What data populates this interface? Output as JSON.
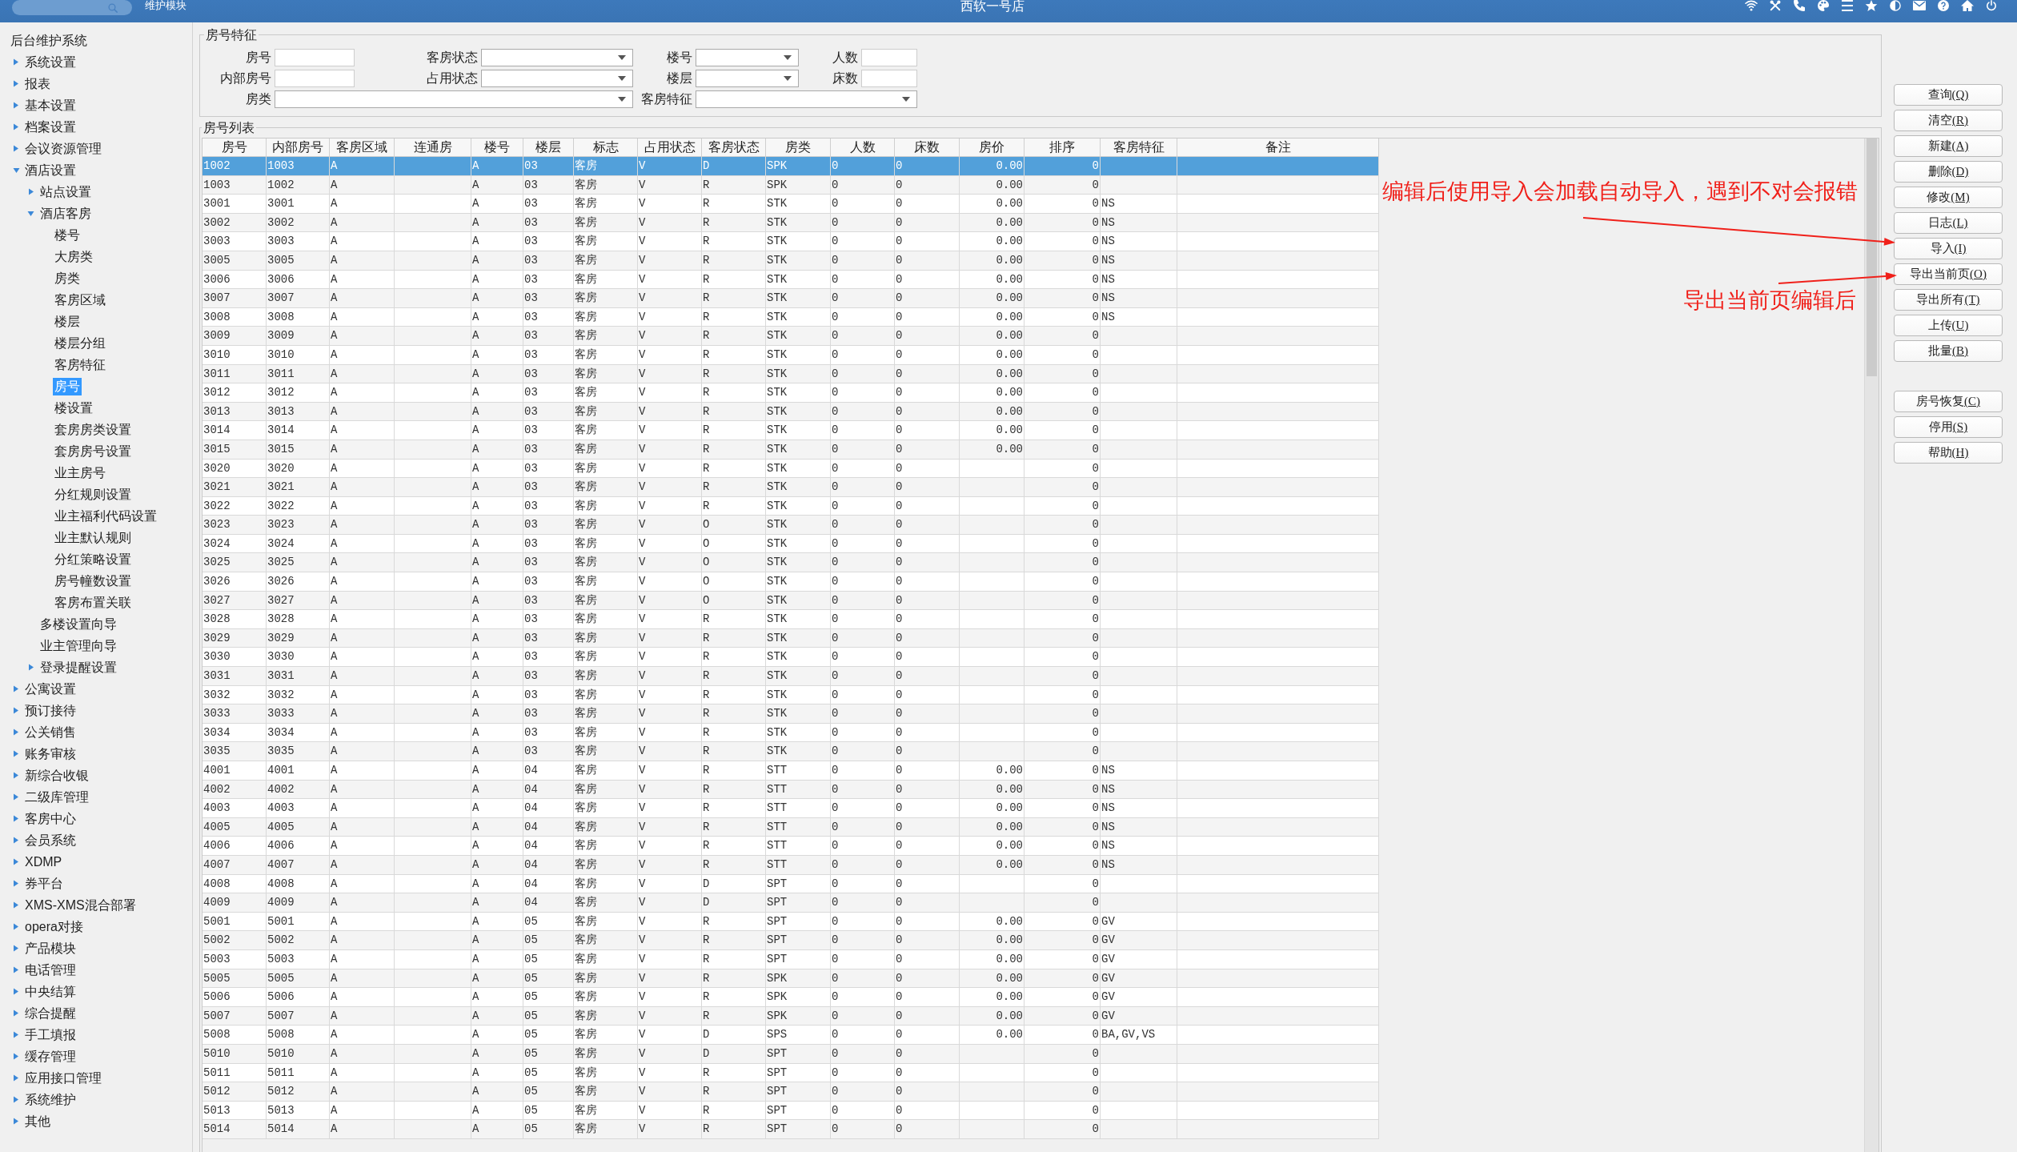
{
  "top_bar": {
    "module": "维护模块",
    "title": "西软一号店"
  },
  "sidebar": {
    "root": "后台维护系统",
    "items": [
      {
        "label": "系统设置",
        "expanded": false,
        "selected": false
      },
      {
        "label": "报表",
        "expanded": false,
        "selected": false
      },
      {
        "label": "基本设置",
        "expanded": false,
        "selected": false
      },
      {
        "label": "档案设置",
        "expanded": false,
        "selected": false
      },
      {
        "label": "会议资源管理",
        "expanded": false,
        "selected": false
      },
      {
        "label": "酒店设置",
        "expanded": true,
        "selected": false,
        "children": [
          {
            "label": "站点设置",
            "expanded": false,
            "selected": false
          },
          {
            "label": "酒店客房",
            "expanded": true,
            "selected": false,
            "children": [
              {
                "label": "楼号",
                "selected": false
              },
              {
                "label": "大房类",
                "selected": false
              },
              {
                "label": "房类",
                "selected": false
              },
              {
                "label": "客房区域",
                "selected": false
              },
              {
                "label": "楼层",
                "selected": false
              },
              {
                "label": "楼层分组",
                "selected": false
              },
              {
                "label": "客房特征",
                "selected": false
              },
              {
                "label": "房号",
                "selected": true
              },
              {
                "label": "楼设置",
                "selected": false
              },
              {
                "label": "套房房类设置",
                "selected": false
              },
              {
                "label": "套房房号设置",
                "selected": false
              },
              {
                "label": "业主房号",
                "selected": false
              },
              {
                "label": "分红规则设置",
                "selected": false
              },
              {
                "label": "业主福利代码设置",
                "selected": false
              },
              {
                "label": "业主默认规则",
                "selected": false
              },
              {
                "label": "分红策略设置",
                "selected": false
              },
              {
                "label": "房号幢数设置",
                "selected": false
              },
              {
                "label": "客房布置关联",
                "selected": false
              }
            ]
          },
          {
            "label": "多楼设置向导",
            "selected": false
          },
          {
            "label": "业主管理向导",
            "selected": false
          },
          {
            "label": "登录提醒设置",
            "expanded": false,
            "selected": false
          }
        ]
      },
      {
        "label": "公寓设置",
        "expanded": false,
        "selected": false
      },
      {
        "label": "预订接待",
        "expanded": false,
        "selected": false
      },
      {
        "label": "公关销售",
        "expanded": false,
        "selected": false
      },
      {
        "label": "账务审核",
        "expanded": false,
        "selected": false
      },
      {
        "label": "新综合收银",
        "expanded": false,
        "selected": false
      },
      {
        "label": "二级库管理",
        "expanded": false,
        "selected": false
      },
      {
        "label": "客房中心",
        "expanded": false,
        "selected": false
      },
      {
        "label": "会员系统",
        "expanded": false,
        "selected": false
      },
      {
        "label": "XDMP",
        "expanded": false,
        "selected": false
      },
      {
        "label": "券平台",
        "expanded": false,
        "selected": false
      },
      {
        "label": "XMS-XMS混合部署",
        "expanded": false,
        "selected": false
      },
      {
        "label": "opera对接",
        "expanded": false,
        "selected": false
      },
      {
        "label": "产品模块",
        "expanded": false,
        "selected": false
      },
      {
        "label": "电话管理",
        "expanded": false,
        "selected": false
      },
      {
        "label": "中央结算",
        "expanded": false,
        "selected": false
      },
      {
        "label": "综合提醒",
        "expanded": false,
        "selected": false
      },
      {
        "label": "手工填报",
        "expanded": false,
        "selected": false
      },
      {
        "label": "缓存管理",
        "expanded": false,
        "selected": false
      },
      {
        "label": "应用接口管理",
        "expanded": false,
        "selected": false
      },
      {
        "label": "系统维护",
        "expanded": false,
        "selected": false
      },
      {
        "label": "其他",
        "expanded": false,
        "selected": false
      }
    ]
  },
  "filter": {
    "title": "房号特征",
    "rows": [
      [
        {
          "label": "房号",
          "kind": "text"
        },
        {
          "label": "客房状态",
          "kind": "select"
        },
        {
          "label": "楼号",
          "kind": "select"
        },
        {
          "label": "人数",
          "kind": "text"
        }
      ],
      [
        {
          "label": "内部房号",
          "kind": "text"
        },
        {
          "label": "占用状态",
          "kind": "select"
        },
        {
          "label": "楼层",
          "kind": "select"
        },
        {
          "label": "床数",
          "kind": "text"
        }
      ],
      [
        {
          "label": "房类",
          "kind": "select"
        },
        null,
        {
          "label": "客房特征",
          "kind": "select"
        },
        null
      ]
    ]
  },
  "room_list": {
    "title": "房号列表",
    "columns": [
      "房号",
      "内部房号",
      "客房区域",
      "连通房",
      "楼号",
      "楼层",
      "标志",
      "占用状态",
      "客房状态",
      "房类",
      "人数",
      "床数",
      "房价",
      "排序",
      "客房特征",
      "备注"
    ],
    "rows": [
      {
        "selected": true,
        "cells": [
          "1002",
          "1003",
          "A",
          null,
          "A",
          "03",
          "客房",
          "V",
          "D",
          "SPK",
          "0",
          "0",
          "0.00",
          "0",
          null,
          null
        ]
      },
      {
        "selected": false,
        "cells": [
          "1003",
          "1002",
          "A",
          null,
          "A",
          "03",
          "客房",
          "V",
          "R",
          "SPK",
          "0",
          "0",
          "0.00",
          "0",
          null,
          null
        ]
      },
      {
        "selected": false,
        "cells": [
          "3001",
          "3001",
          "A",
          null,
          "A",
          "03",
          "客房",
          "V",
          "R",
          "STK",
          "0",
          "0",
          "0.00",
          "0",
          "NS",
          null
        ]
      },
      {
        "selected": false,
        "cells": [
          "3002",
          "3002",
          "A",
          null,
          "A",
          "03",
          "客房",
          "V",
          "R",
          "STK",
          "0",
          "0",
          "0.00",
          "0",
          "NS",
          null
        ]
      },
      {
        "selected": false,
        "cells": [
          "3003",
          "3003",
          "A",
          null,
          "A",
          "03",
          "客房",
          "V",
          "R",
          "STK",
          "0",
          "0",
          "0.00",
          "0",
          "NS",
          null
        ]
      },
      {
        "selected": false,
        "cells": [
          "3005",
          "3005",
          "A",
          null,
          "A",
          "03",
          "客房",
          "V",
          "R",
          "STK",
          "0",
          "0",
          "0.00",
          "0",
          "NS",
          null
        ]
      },
      {
        "selected": false,
        "cells": [
          "3006",
          "3006",
          "A",
          null,
          "A",
          "03",
          "客房",
          "V",
          "R",
          "STK",
          "0",
          "0",
          "0.00",
          "0",
          "NS",
          null
        ]
      },
      {
        "selected": false,
        "cells": [
          "3007",
          "3007",
          "A",
          null,
          "A",
          "03",
          "客房",
          "V",
          "R",
          "STK",
          "0",
          "0",
          "0.00",
          "0",
          "NS",
          null
        ]
      },
      {
        "selected": false,
        "cells": [
          "3008",
          "3008",
          "A",
          null,
          "A",
          "03",
          "客房",
          "V",
          "R",
          "STK",
          "0",
          "0",
          "0.00",
          "0",
          "NS",
          null
        ]
      },
      {
        "selected": false,
        "cells": [
          "3009",
          "3009",
          "A",
          null,
          "A",
          "03",
          "客房",
          "V",
          "R",
          "STK",
          "0",
          "0",
          "0.00",
          "0",
          null,
          null
        ]
      },
      {
        "selected": false,
        "cells": [
          "3010",
          "3010",
          "A",
          null,
          "A",
          "03",
          "客房",
          "V",
          "R",
          "STK",
          "0",
          "0",
          "0.00",
          "0",
          null,
          null
        ]
      },
      {
        "selected": false,
        "cells": [
          "3011",
          "3011",
          "A",
          null,
          "A",
          "03",
          "客房",
          "V",
          "R",
          "STK",
          "0",
          "0",
          "0.00",
          "0",
          null,
          null
        ]
      },
      {
        "selected": false,
        "cells": [
          "3012",
          "3012",
          "A",
          null,
          "A",
          "03",
          "客房",
          "V",
          "R",
          "STK",
          "0",
          "0",
          "0.00",
          "0",
          null,
          null
        ]
      },
      {
        "selected": false,
        "cells": [
          "3013",
          "3013",
          "A",
          null,
          "A",
          "03",
          "客房",
          "V",
          "R",
          "STK",
          "0",
          "0",
          "0.00",
          "0",
          null,
          null
        ]
      },
      {
        "selected": false,
        "cells": [
          "3014",
          "3014",
          "A",
          null,
          "A",
          "03",
          "客房",
          "V",
          "R",
          "STK",
          "0",
          "0",
          "0.00",
          "0",
          null,
          null
        ]
      },
      {
        "selected": false,
        "cells": [
          "3015",
          "3015",
          "A",
          null,
          "A",
          "03",
          "客房",
          "V",
          "R",
          "STK",
          "0",
          "0",
          "0.00",
          "0",
          null,
          null
        ]
      },
      {
        "selected": false,
        "cells": [
          "3020",
          "3020",
          "A",
          null,
          "A",
          "03",
          "客房",
          "V",
          "R",
          "STK",
          "0",
          "0",
          null,
          "0",
          null,
          null
        ]
      },
      {
        "selected": false,
        "cells": [
          "3021",
          "3021",
          "A",
          null,
          "A",
          "03",
          "客房",
          "V",
          "R",
          "STK",
          "0",
          "0",
          null,
          "0",
          null,
          null
        ]
      },
      {
        "selected": false,
        "cells": [
          "3022",
          "3022",
          "A",
          null,
          "A",
          "03",
          "客房",
          "V",
          "R",
          "STK",
          "0",
          "0",
          null,
          "0",
          null,
          null
        ]
      },
      {
        "selected": false,
        "cells": [
          "3023",
          "3023",
          "A",
          null,
          "A",
          "03",
          "客房",
          "V",
          "O",
          "STK",
          "0",
          "0",
          null,
          "0",
          null,
          null
        ]
      },
      {
        "selected": false,
        "cells": [
          "3024",
          "3024",
          "A",
          null,
          "A",
          "03",
          "客房",
          "V",
          "O",
          "STK",
          "0",
          "0",
          null,
          "0",
          null,
          null
        ]
      },
      {
        "selected": false,
        "cells": [
          "3025",
          "3025",
          "A",
          null,
          "A",
          "03",
          "客房",
          "V",
          "O",
          "STK",
          "0",
          "0",
          null,
          "0",
          null,
          null
        ]
      },
      {
        "selected": false,
        "cells": [
          "3026",
          "3026",
          "A",
          null,
          "A",
          "03",
          "客房",
          "V",
          "O",
          "STK",
          "0",
          "0",
          null,
          "0",
          null,
          null
        ]
      },
      {
        "selected": false,
        "cells": [
          "3027",
          "3027",
          "A",
          null,
          "A",
          "03",
          "客房",
          "V",
          "O",
          "STK",
          "0",
          "0",
          null,
          "0",
          null,
          null
        ]
      },
      {
        "selected": false,
        "cells": [
          "3028",
          "3028",
          "A",
          null,
          "A",
          "03",
          "客房",
          "V",
          "R",
          "STK",
          "0",
          "0",
          null,
          "0",
          null,
          null
        ]
      },
      {
        "selected": false,
        "cells": [
          "3029",
          "3029",
          "A",
          null,
          "A",
          "03",
          "客房",
          "V",
          "R",
          "STK",
          "0",
          "0",
          null,
          "0",
          null,
          null
        ]
      },
      {
        "selected": false,
        "cells": [
          "3030",
          "3030",
          "A",
          null,
          "A",
          "03",
          "客房",
          "V",
          "R",
          "STK",
          "0",
          "0",
          null,
          "0",
          null,
          null
        ]
      },
      {
        "selected": false,
        "cells": [
          "3031",
          "3031",
          "A",
          null,
          "A",
          "03",
          "客房",
          "V",
          "R",
          "STK",
          "0",
          "0",
          null,
          "0",
          null,
          null
        ]
      },
      {
        "selected": false,
        "cells": [
          "3032",
          "3032",
          "A",
          null,
          "A",
          "03",
          "客房",
          "V",
          "R",
          "STK",
          "0",
          "0",
          null,
          "0",
          null,
          null
        ]
      },
      {
        "selected": false,
        "cells": [
          "3033",
          "3033",
          "A",
          null,
          "A",
          "03",
          "客房",
          "V",
          "R",
          "STK",
          "0",
          "0",
          null,
          "0",
          null,
          null
        ]
      },
      {
        "selected": false,
        "cells": [
          "3034",
          "3034",
          "A",
          null,
          "A",
          "03",
          "客房",
          "V",
          "R",
          "STK",
          "0",
          "0",
          null,
          "0",
          null,
          null
        ]
      },
      {
        "selected": false,
        "cells": [
          "3035",
          "3035",
          "A",
          null,
          "A",
          "03",
          "客房",
          "V",
          "R",
          "STK",
          "0",
          "0",
          null,
          "0",
          null,
          null
        ]
      },
      {
        "selected": false,
        "cells": [
          "4001",
          "4001",
          "A",
          null,
          "A",
          "04",
          "客房",
          "V",
          "R",
          "STT",
          "0",
          "0",
          "0.00",
          "0",
          "NS",
          null
        ]
      },
      {
        "selected": false,
        "cells": [
          "4002",
          "4002",
          "A",
          null,
          "A",
          "04",
          "客房",
          "V",
          "R",
          "STT",
          "0",
          "0",
          "0.00",
          "0",
          "NS",
          null
        ]
      },
      {
        "selected": false,
        "cells": [
          "4003",
          "4003",
          "A",
          null,
          "A",
          "04",
          "客房",
          "V",
          "R",
          "STT",
          "0",
          "0",
          "0.00",
          "0",
          "NS",
          null
        ]
      },
      {
        "selected": false,
        "cells": [
          "4005",
          "4005",
          "A",
          null,
          "A",
          "04",
          "客房",
          "V",
          "R",
          "STT",
          "0",
          "0",
          "0.00",
          "0",
          "NS",
          null
        ]
      },
      {
        "selected": false,
        "cells": [
          "4006",
          "4006",
          "A",
          null,
          "A",
          "04",
          "客房",
          "V",
          "R",
          "STT",
          "0",
          "0",
          "0.00",
          "0",
          "NS",
          null
        ]
      },
      {
        "selected": false,
        "cells": [
          "4007",
          "4007",
          "A",
          null,
          "A",
          "04",
          "客房",
          "V",
          "R",
          "STT",
          "0",
          "0",
          "0.00",
          "0",
          "NS",
          null
        ]
      },
      {
        "selected": false,
        "cells": [
          "4008",
          "4008",
          "A",
          null,
          "A",
          "04",
          "客房",
          "V",
          "D",
          "SPT",
          "0",
          "0",
          null,
          "0",
          null,
          null
        ]
      },
      {
        "selected": false,
        "cells": [
          "4009",
          "4009",
          "A",
          null,
          "A",
          "04",
          "客房",
          "V",
          "D",
          "SPT",
          "0",
          "0",
          null,
          "0",
          null,
          null
        ]
      },
      {
        "selected": false,
        "cells": [
          "5001",
          "5001",
          "A",
          null,
          "A",
          "05",
          "客房",
          "V",
          "R",
          "SPT",
          "0",
          "0",
          "0.00",
          "0",
          "GV",
          null
        ]
      },
      {
        "selected": false,
        "cells": [
          "5002",
          "5002",
          "A",
          null,
          "A",
          "05",
          "客房",
          "V",
          "R",
          "SPT",
          "0",
          "0",
          "0.00",
          "0",
          "GV",
          null
        ]
      },
      {
        "selected": false,
        "cells": [
          "5003",
          "5003",
          "A",
          null,
          "A",
          "05",
          "客房",
          "V",
          "R",
          "SPT",
          "0",
          "0",
          "0.00",
          "0",
          "GV",
          null
        ]
      },
      {
        "selected": false,
        "cells": [
          "5005",
          "5005",
          "A",
          null,
          "A",
          "05",
          "客房",
          "V",
          "R",
          "SPK",
          "0",
          "0",
          "0.00",
          "0",
          "GV",
          null
        ]
      },
      {
        "selected": false,
        "cells": [
          "5006",
          "5006",
          "A",
          null,
          "A",
          "05",
          "客房",
          "V",
          "R",
          "SPK",
          "0",
          "0",
          "0.00",
          "0",
          "GV",
          null
        ]
      },
      {
        "selected": false,
        "cells": [
          "5007",
          "5007",
          "A",
          null,
          "A",
          "05",
          "客房",
          "V",
          "R",
          "SPK",
          "0",
          "0",
          "0.00",
          "0",
          "GV",
          null
        ]
      },
      {
        "selected": false,
        "cells": [
          "5008",
          "5008",
          "A",
          null,
          "A",
          "05",
          "客房",
          "V",
          "D",
          "SPS",
          "0",
          "0",
          "0.00",
          "0",
          "BA,GV,VS",
          null
        ]
      },
      {
        "selected": false,
        "cells": [
          "5010",
          "5010",
          "A",
          null,
          "A",
          "05",
          "客房",
          "V",
          "D",
          "SPT",
          "0",
          "0",
          null,
          "0",
          null,
          null
        ]
      },
      {
        "selected": false,
        "cells": [
          "5011",
          "5011",
          "A",
          null,
          "A",
          "05",
          "客房",
          "V",
          "R",
          "SPT",
          "0",
          "0",
          null,
          "0",
          null,
          null
        ]
      },
      {
        "selected": false,
        "cells": [
          "5012",
          "5012",
          "A",
          null,
          "A",
          "05",
          "客房",
          "V",
          "R",
          "SPT",
          "0",
          "0",
          null,
          "0",
          null,
          null
        ]
      },
      {
        "selected": false,
        "cells": [
          "5013",
          "5013",
          "A",
          null,
          "A",
          "05",
          "客房",
          "V",
          "R",
          "SPT",
          "0",
          "0",
          null,
          "0",
          null,
          null
        ]
      },
      {
        "selected": false,
        "cells": [
          "5014",
          "5014",
          "A",
          null,
          "A",
          "05",
          "客房",
          "V",
          "R",
          "SPT",
          "0",
          "0",
          null,
          "0",
          null,
          null
        ]
      }
    ]
  },
  "buttons": [
    [
      {
        "label": "查询",
        "hotkey": "(Q)"
      },
      {
        "label": "清空",
        "hotkey": "(R)"
      },
      {
        "label": "新建",
        "hotkey": "(A)"
      },
      {
        "label": "删除",
        "hotkey": "(D)"
      },
      {
        "label": "修改",
        "hotkey": "(M)"
      },
      {
        "label": "日志",
        "hotkey": "(L)"
      },
      {
        "label": "导入",
        "hotkey": "(I)"
      },
      {
        "label": "导出当前页",
        "hotkey": "(O)"
      },
      {
        "label": "导出所有",
        "hotkey": "(T)"
      },
      {
        "label": "上传",
        "hotkey": "(U)"
      },
      {
        "label": "批量",
        "hotkey": "(B)"
      }
    ],
    [
      {
        "label": "房号恢复",
        "hotkey": "(C)"
      },
      {
        "label": "停用",
        "hotkey": "(S)"
      },
      {
        "label": "帮助",
        "hotkey": "(H)"
      }
    ]
  ],
  "annotations": [
    {
      "text": "编辑后使用导入会加载自动导入，遇到不对会报错"
    },
    {
      "text": "导出当前页编辑后"
    }
  ]
}
